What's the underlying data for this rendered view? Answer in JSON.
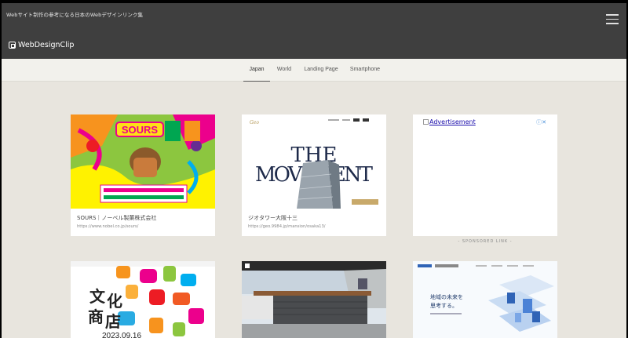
{
  "header": {
    "tagline": "Webサイト制作の参考になる日本のWebデザインリンク集",
    "logo": "WebDesignClip"
  },
  "nav": {
    "tabs": [
      {
        "label": "Japan",
        "active": true
      },
      {
        "label": "World",
        "active": false
      },
      {
        "label": "Landing Page",
        "active": false
      },
      {
        "label": "Smartphone",
        "active": false
      }
    ]
  },
  "cards": [
    {
      "title": "SOURS｜ノーベル製菓株式会社",
      "url": "https://www.nobel.co.jp/sours/",
      "thumb_text": "SOURS"
    },
    {
      "title": "ジオタワー大阪十三",
      "url": "https://geo.9984.jp/mansion/osaka13/",
      "thumb_text": "THE MOVEMENT"
    },
    {
      "title": "",
      "url": "",
      "thumb_text": "商文化店"
    },
    {
      "title": "",
      "url": "",
      "thumb_text": ""
    },
    {
      "title": "",
      "url": "",
      "thumb_text": "地域の未来を思考する。"
    }
  ],
  "ad": {
    "link_text": "Advertisement",
    "sponsored_label": "- SPONSORED LINK -"
  },
  "colors": {
    "header_bg": "#3f3f3f",
    "nav_bg": "#f2f1ec",
    "page_bg": "#e8e5de"
  }
}
